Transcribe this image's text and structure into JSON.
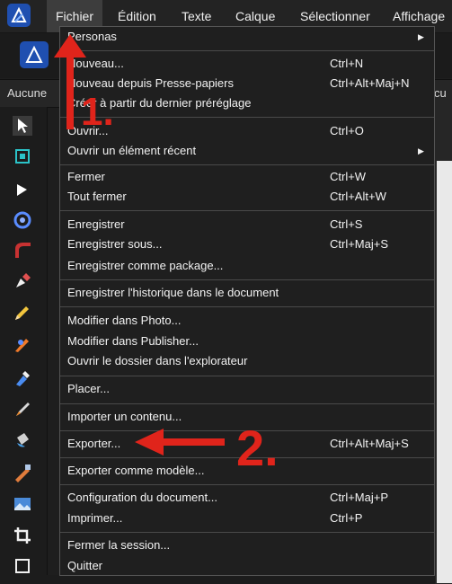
{
  "menubar": {
    "app_icon": "affinity-designer-logo-icon",
    "items": [
      {
        "label": "Fichier"
      },
      {
        "label": "Édition"
      },
      {
        "label": "Texte"
      },
      {
        "label": "Calque"
      },
      {
        "label": "Sélectionner"
      },
      {
        "label": "Affichage"
      }
    ]
  },
  "context_bar": {
    "left_label": "Aucune",
    "right_label": "cu"
  },
  "tools": [
    "move-tool-icon",
    "artboard-tool-icon",
    "node-tool-icon",
    "corner-tool-icon",
    "pencil-curve-icon",
    "pen-tool-icon",
    "pencil-tool-icon",
    "vector-brush-icon",
    "fill-tool-icon",
    "paint-brush-icon",
    "transparency-tool-icon",
    "pixel-brush-icon",
    "place-image-icon",
    "crop-tool-icon",
    "rectangle-tool-icon"
  ],
  "dropdown": {
    "items": [
      {
        "label": "Personas",
        "shortcut": "",
        "submenu": true
      },
      {
        "label": "Nouveau...",
        "shortcut": "Ctrl+N"
      },
      {
        "label": "Nouveau depuis Presse-papiers",
        "shortcut": "Ctrl+Alt+Maj+N"
      },
      {
        "label": "Créer à partir du dernier préréglage",
        "shortcut": ""
      },
      {
        "label": "Ouvrir...",
        "shortcut": "Ctrl+O"
      },
      {
        "label": "Ouvrir un élément récent",
        "shortcut": "",
        "submenu": true
      },
      {
        "label": "Fermer",
        "shortcut": "Ctrl+W"
      },
      {
        "label": "Tout fermer",
        "shortcut": "Ctrl+Alt+W"
      },
      {
        "label": "Enregistrer",
        "shortcut": "Ctrl+S"
      },
      {
        "label": "Enregistrer sous...",
        "shortcut": "Ctrl+Maj+S"
      },
      {
        "label": "Enregistrer comme package...",
        "shortcut": ""
      },
      {
        "label": "Enregistrer l'historique dans le document",
        "shortcut": ""
      },
      {
        "label": "Modifier dans Photo...",
        "shortcut": ""
      },
      {
        "label": "Modifier dans Publisher...",
        "shortcut": ""
      },
      {
        "label": "Ouvrir le dossier dans l'explorateur",
        "shortcut": ""
      },
      {
        "label": "Placer...",
        "shortcut": ""
      },
      {
        "label": "Importer un contenu...",
        "shortcut": ""
      },
      {
        "label": "Exporter...",
        "shortcut": "Ctrl+Alt+Maj+S"
      },
      {
        "label": "Exporter comme modèle...",
        "shortcut": ""
      },
      {
        "label": "Configuration du document...",
        "shortcut": "Ctrl+Maj+P"
      },
      {
        "label": "Imprimer...",
        "shortcut": "Ctrl+P"
      },
      {
        "label": "Fermer la session...",
        "shortcut": ""
      },
      {
        "label": "Quitter",
        "shortcut": ""
      }
    ]
  },
  "annotations": {
    "step1": "1.",
    "step2": "2.",
    "color": "#e0241b"
  }
}
